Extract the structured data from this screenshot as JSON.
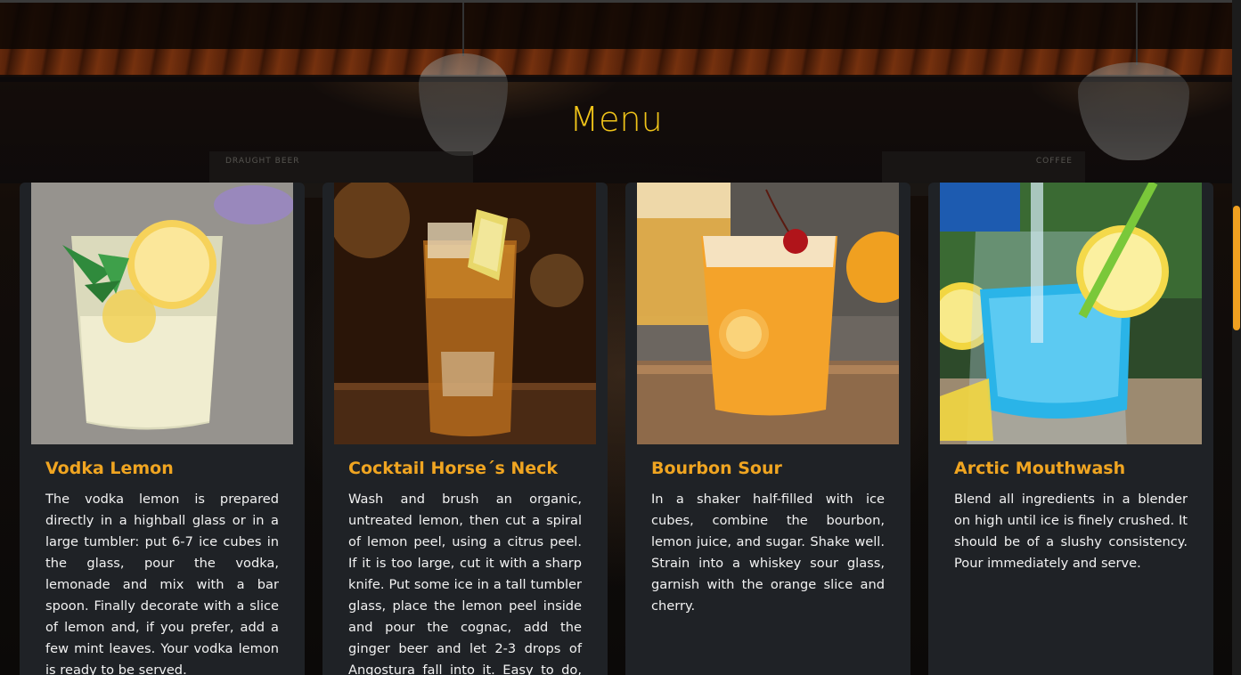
{
  "page": {
    "title": "Menu"
  },
  "colors": {
    "title": "#f0c419",
    "card_heading": "#f0a521",
    "card_background": "#1f2226",
    "body_text": "#f2f2f2",
    "scrollbar_thumb": "#f0a020"
  },
  "background": {
    "board_text": "DRAUGHT  BEER",
    "board_text_2": "COFFEE"
  },
  "cards": [
    {
      "title": "Vodka Lemon",
      "image": "vodka-lemon-photo",
      "description": "The vodka lemon is prepared directly in a highball glass or in a large tumbler: put 6-7 ice cubes in the glass, pour the vodka, lemonade and mix with a bar spoon. Finally decorate with a slice of lemon and, if you prefer, add a few mint leaves. Your vodka lemon is ready to be served."
    },
    {
      "title": "Cocktail Horse´s Neck",
      "image": "horses-neck-photo",
      "description": "Wash and brush an organic, untreated lemon, then cut a spiral of lemon peel, using a citrus peel. If it is too large, cut it with a sharp knife. Put some ice in a tall tumbler glass, place the lemon peel inside and pour the cognac, add the ginger beer and let 2-3 drops of Angostura fall into it. Easy to do, but once you"
    },
    {
      "title": "Bourbon Sour",
      "image": "bourbon-sour-photo",
      "description": "In a shaker half-filled with ice cubes, combine the bourbon, lemon juice, and sugar. Shake well. Strain into a whiskey sour glass, garnish with the orange slice and cherry."
    },
    {
      "title": "Arctic Mouthwash",
      "image": "arctic-mouthwash-photo",
      "description": "Blend all ingredients in a blender on high until ice is finely crushed. It should be of a slushy consistency. Pour immediately and serve."
    }
  ]
}
